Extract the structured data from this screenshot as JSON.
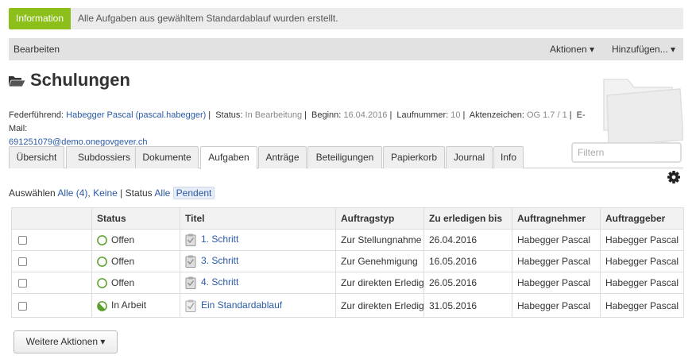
{
  "info": {
    "badge": "Information",
    "message": "Alle Aufgaben aus gewähltem Standardablauf wurden erstellt."
  },
  "menu": {
    "edit": "Bearbeiten",
    "actions": "Aktionen ▾",
    "add": "Hinzufügen... ▾"
  },
  "page": {
    "title": "Schulungen"
  },
  "meta": {
    "lead_label": "Federführend:",
    "lead_value": "Habegger Pascal (pascal.habegger)",
    "status_label": "Status:",
    "status_value": "In Bearbeitung",
    "begin_label": "Beginn:",
    "begin_value": "16.04.2016",
    "number_label": "Laufnummer:",
    "number_value": "10",
    "ref_label": "Aktenzeichen:",
    "ref_value": "OG 1.7 / 1",
    "email_label": "E-Mail:",
    "email_value": "691251079@demo.onegovgever.ch"
  },
  "filter": {
    "placeholder": "Filtern"
  },
  "tabs": [
    {
      "label": "Übersicht"
    },
    {
      "label": "Subdossiers"
    },
    {
      "label": "Dokumente"
    },
    {
      "label": "Aufgaben"
    },
    {
      "label": "Anträge"
    },
    {
      "label": "Beteiligungen"
    },
    {
      "label": "Papierkorb"
    },
    {
      "label": "Journal"
    },
    {
      "label": "Info"
    }
  ],
  "selection": {
    "label": "Auswählen",
    "all": "Alle (4)",
    "sep": ",",
    "none": "Keine",
    "bar": "|",
    "status_label": "Status",
    "status_all": "Alle",
    "status_pending": "Pendent"
  },
  "table": {
    "headers": [
      "",
      "Status",
      "Titel",
      "Auftragstyp",
      "Zu erledigen bis",
      "Auftragnehmer",
      "Auftraggeber"
    ],
    "rows": [
      {
        "status": "Offen",
        "title": "1. Schritt",
        "type": "Zur Stellungnahme",
        "due": "26.04.2016",
        "contractor": "Habegger Pascal",
        "issuer": "Habegger Pascal"
      },
      {
        "status": "Offen",
        "title": "3. Schritt",
        "type": "Zur Genehmigung",
        "due": "16.05.2016",
        "contractor": "Habegger Pascal",
        "issuer": "Habegger Pascal"
      },
      {
        "status": "Offen",
        "title": "4. Schritt",
        "type": "Zur direkten Erledigung",
        "due": "26.05.2016",
        "contractor": "Habegger Pascal",
        "issuer": "Habegger Pascal"
      },
      {
        "status": "In Arbeit",
        "title": "Ein Standardablauf",
        "type": "Zur direkten Erledigung",
        "due": "31.05.2016",
        "contractor": "Habegger Pascal",
        "issuer": "Habegger Pascal"
      }
    ]
  },
  "buttons": {
    "more_actions": "Weitere Aktionen ▾"
  },
  "colors": {
    "info_green": "#8cbf1a",
    "open_green": "#5aa02c",
    "link_blue": "#2a5aa7"
  },
  "icons": [
    "folder-open-icon",
    "gear-icon",
    "status-open-icon",
    "status-in-progress-icon",
    "task-clipboard-icon",
    "process-clipboard-icon"
  ]
}
